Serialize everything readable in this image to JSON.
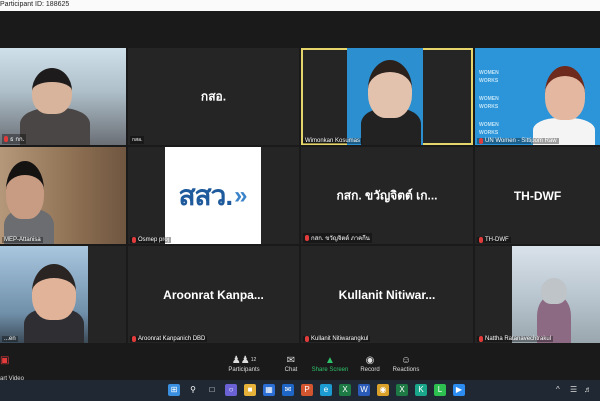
{
  "window": {
    "participant_id": "Participant ID: 188625"
  },
  "tiles": [
    {
      "name": "ธ กก.",
      "display": ""
    },
    {
      "name": "กสอ.",
      "display": "กสอ."
    },
    {
      "name": "Wimonkan Kosumas",
      "display": ""
    },
    {
      "name": "UN Women - Sittipom Raw",
      "display": ""
    },
    {
      "name": "MEP-Attanisa",
      "display": ""
    },
    {
      "name": "Osmep proj",
      "display": "",
      "logo": "สสว."
    },
    {
      "name": "กสก. ขวัญจิตต์ ภาคกีน",
      "display": "กสก. ขวัญจิตต์ เก..."
    },
    {
      "name": "TH-DWF",
      "display": "TH-DWF"
    },
    {
      "name": "...en",
      "display": ""
    },
    {
      "name": "Aroonrat Kanpanich DBD",
      "display": "Aroonrat Kanpa..."
    },
    {
      "name": "Kullanit Nitiwarangkul",
      "display": "Kullanit Nitiwar..."
    },
    {
      "name": "Nattha Ratanavechtrakul",
      "display": ""
    }
  ],
  "un_words": [
    "WOMEN",
    "WORKS",
    "WOMEN",
    "WORKS",
    "WOMEN",
    "WORKS"
  ],
  "controls": {
    "start_video": "art Video",
    "participants": "Participants",
    "participants_count": "12",
    "chat": "Chat",
    "share_screen": "Share Screen",
    "record": "Record",
    "reactions": "Reactions"
  },
  "taskbar": {
    "icons": [
      "windows-icon",
      "search-icon",
      "task-view-icon",
      "chat-icon",
      "explorer-icon",
      "store-icon",
      "mail-icon",
      "powerpoint-icon",
      "edge-icon",
      "excel-icon",
      "word-icon",
      "chrome-icon",
      "excel-icon",
      "kaspersky-icon",
      "line-icon",
      "zoom-icon"
    ]
  },
  "colors": {
    "active_border": "#e5d56a",
    "share_green": "#2ec36b",
    "muted_red": "#e23b3b",
    "taskbar": "#202933"
  }
}
